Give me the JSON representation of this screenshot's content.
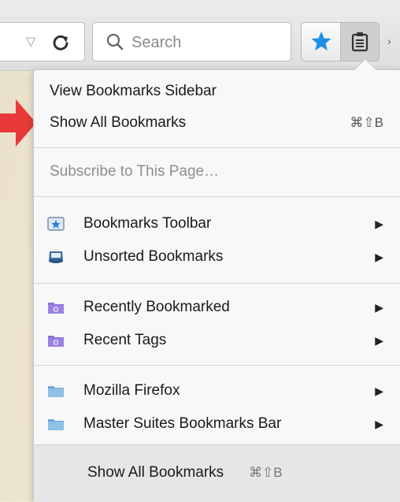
{
  "toolbar": {
    "dropmarker": "▽",
    "reload_glyph": "C",
    "search_placeholder": "Search",
    "bookmark_star_color": "#1e8fe5",
    "more_glyph": "›"
  },
  "menu": {
    "view_sidebar": "View Bookmarks Sidebar",
    "show_all": {
      "label": "Show All Bookmarks",
      "shortcut": "⌘⇧B"
    },
    "subscribe": "Subscribe to This Page…",
    "items": [
      {
        "label": "Bookmarks Toolbar",
        "icon": "bookmarks-toolbar-icon",
        "submenu": "▶"
      },
      {
        "label": "Unsorted Bookmarks",
        "icon": "unsorted-bookmarks-icon",
        "submenu": "▶"
      },
      {
        "label": "Recently Bookmarked",
        "icon": "smart-folder-icon",
        "submenu": "▶"
      },
      {
        "label": "Recent Tags",
        "icon": "smart-folder-icon",
        "submenu": "▶"
      },
      {
        "label": "Mozilla Firefox",
        "icon": "folder-icon",
        "submenu": "▶"
      },
      {
        "label": "Master Suites Bookmarks Bar",
        "icon": "folder-icon",
        "submenu": "▶"
      }
    ],
    "footer": {
      "label": "Show All Bookmarks",
      "shortcut": "⌘⇧B"
    }
  },
  "colors": {
    "pointer_arrow": "#e83a3a",
    "smart_folder": "#8a6fd6",
    "folder": "#7fb4dd"
  }
}
